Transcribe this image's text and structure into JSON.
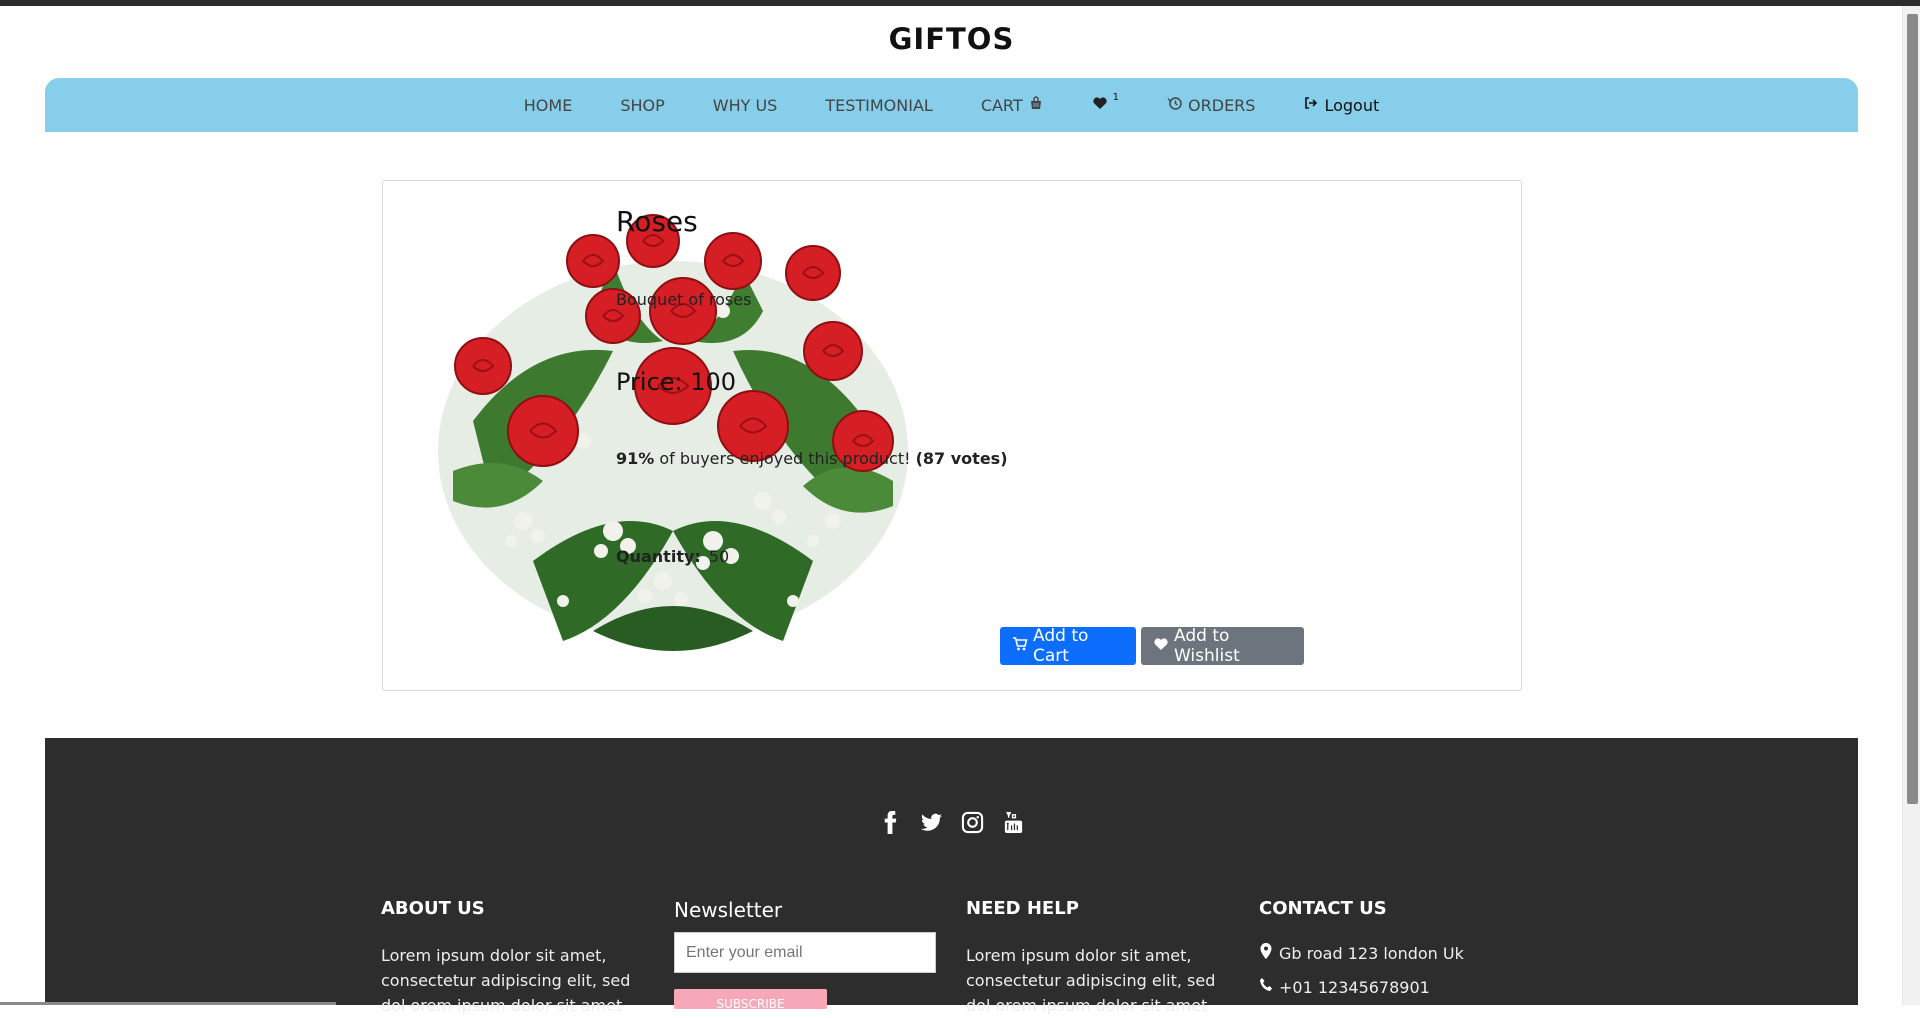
{
  "brand": "GIFTOS",
  "nav": {
    "home": "HOME",
    "shop": "SHOP",
    "why_us": "WHY US",
    "testimonial": "TESTIMONIAL",
    "cart": "CART",
    "wishlist_count": "1",
    "orders": "ORDERS",
    "logout": "Logout"
  },
  "product": {
    "title": "Roses",
    "description": "Bouquet of roses",
    "price_label": "Price: 100",
    "rating_percent": "91%",
    "rating_text": " of buyers enjoyed this product! ",
    "rating_votes": "(87 votes)",
    "quantity_label": "Quantity:",
    "quantity_value": "50",
    "add_to_cart": "Add to Cart",
    "add_to_wishlist": "Add to Wishlist"
  },
  "footer": {
    "about_title": "ABOUT US",
    "about_text": "Lorem ipsum dolor sit amet, consectetur adipiscing elit, sed dol orem ipsum dolor sit amet",
    "newsletter_title": "Newsletter",
    "email_placeholder": "Enter your email",
    "subscribe_label": "SUBSCRIBE",
    "help_title": "NEED HELP",
    "help_text": "Lorem ipsum dolor sit amet, consectetur adipiscing elit, sed dol orem ipsum dolor sit amet",
    "contact_title": "CONTACT US",
    "address": "Gb road 123 london Uk",
    "phone": "+01 12345678901"
  },
  "colors": {
    "nav_bg": "#87ceeb",
    "primary": "#0d6efd",
    "secondary": "#6c757d",
    "footer_bg": "#2d2d2d"
  }
}
